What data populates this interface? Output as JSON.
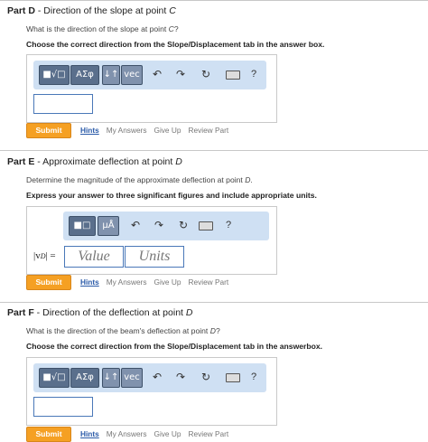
{
  "parts": [
    {
      "id": "D",
      "label": "Part D",
      "sep": " - ",
      "title_main": "Direction of the slope at point ",
      "title_var": "C",
      "question_main": "What is the direction of the slope at point ",
      "question_var": "C",
      "question_end": "?",
      "instruction": "Choose the correct direction from the Slope/Displacement tab in the answer box."
    },
    {
      "id": "E",
      "label": "Part E",
      "sep": " - ",
      "title_main": "Approximate deflection at point ",
      "title_var": "D",
      "question_main": "Determine the magnitude of the approximate deflection at point ",
      "question_var": "D",
      "question_end": ".",
      "instruction": "Express your answer to three significant figures and include appropriate units.",
      "value_label": "|v",
      "value_label_sub": "D",
      "value_label_end": "| =",
      "value_placeholder": "Value",
      "units_placeholder": "Units"
    },
    {
      "id": "F",
      "label": "Part F",
      "sep": " - ",
      "title_main": "Direction of the deflection at point ",
      "title_var": "D",
      "question_main": "What is the direction of the beam's deflection at point ",
      "question_var": "D",
      "question_end": "?",
      "instruction": "Choose the correct direction from the Slope/Displacement tab in the answerbox."
    }
  ],
  "toolbar": {
    "templates": "■√□",
    "greek": "AΣφ",
    "arrows": "↓↑",
    "vec": "vec",
    "units_tpl": "■□",
    "mu_a": "μÅ",
    "undo": "↶",
    "redo": "↷",
    "reset": "↻",
    "help": "?"
  },
  "actions": {
    "submit": "Submit",
    "hints": "Hints",
    "my_answers": "My Answers",
    "give_up": "Give Up",
    "review_part": "Review Part"
  }
}
